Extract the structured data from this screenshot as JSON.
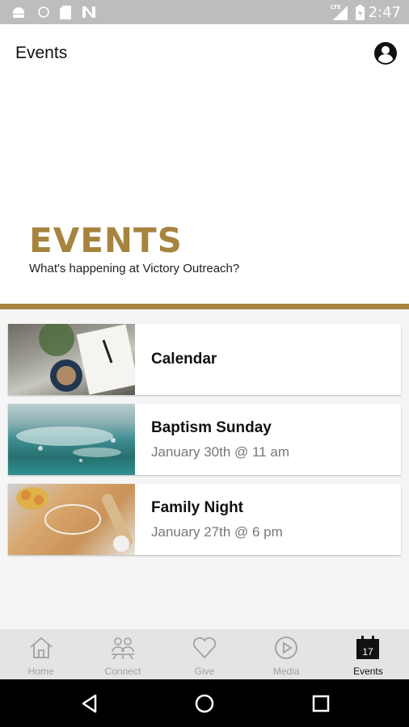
{
  "status_bar": {
    "time": "2:47",
    "network_label": "LTE",
    "icons": [
      "android-icon",
      "sync-icon",
      "sd-card-icon",
      "n-icon",
      "signal-icon",
      "battery-icon"
    ]
  },
  "app_bar": {
    "title": "Events",
    "profile_icon": "profile-icon"
  },
  "hero": {
    "title": "EVENTS",
    "subtitle": "What's happening at Victory Outreach?",
    "accent_color": "#a8833e"
  },
  "cards": [
    {
      "title": "Calendar",
      "subtitle": ""
    },
    {
      "title": "Baptism Sunday",
      "subtitle": "January 30th @ 11 am"
    },
    {
      "title": "Family Night",
      "subtitle": "January 27th @ 6 pm"
    }
  ],
  "bottom_nav": {
    "items": [
      {
        "label": "Home",
        "icon": "home-icon"
      },
      {
        "label": "Connect",
        "icon": "people-icon"
      },
      {
        "label": "Give",
        "icon": "heart-icon"
      },
      {
        "label": "Media",
        "icon": "play-icon"
      },
      {
        "label": "Events",
        "icon": "calendar-icon",
        "badge": "17",
        "active": true
      }
    ]
  },
  "system_nav": [
    "back-icon",
    "home-circle-icon",
    "recents-icon"
  ]
}
